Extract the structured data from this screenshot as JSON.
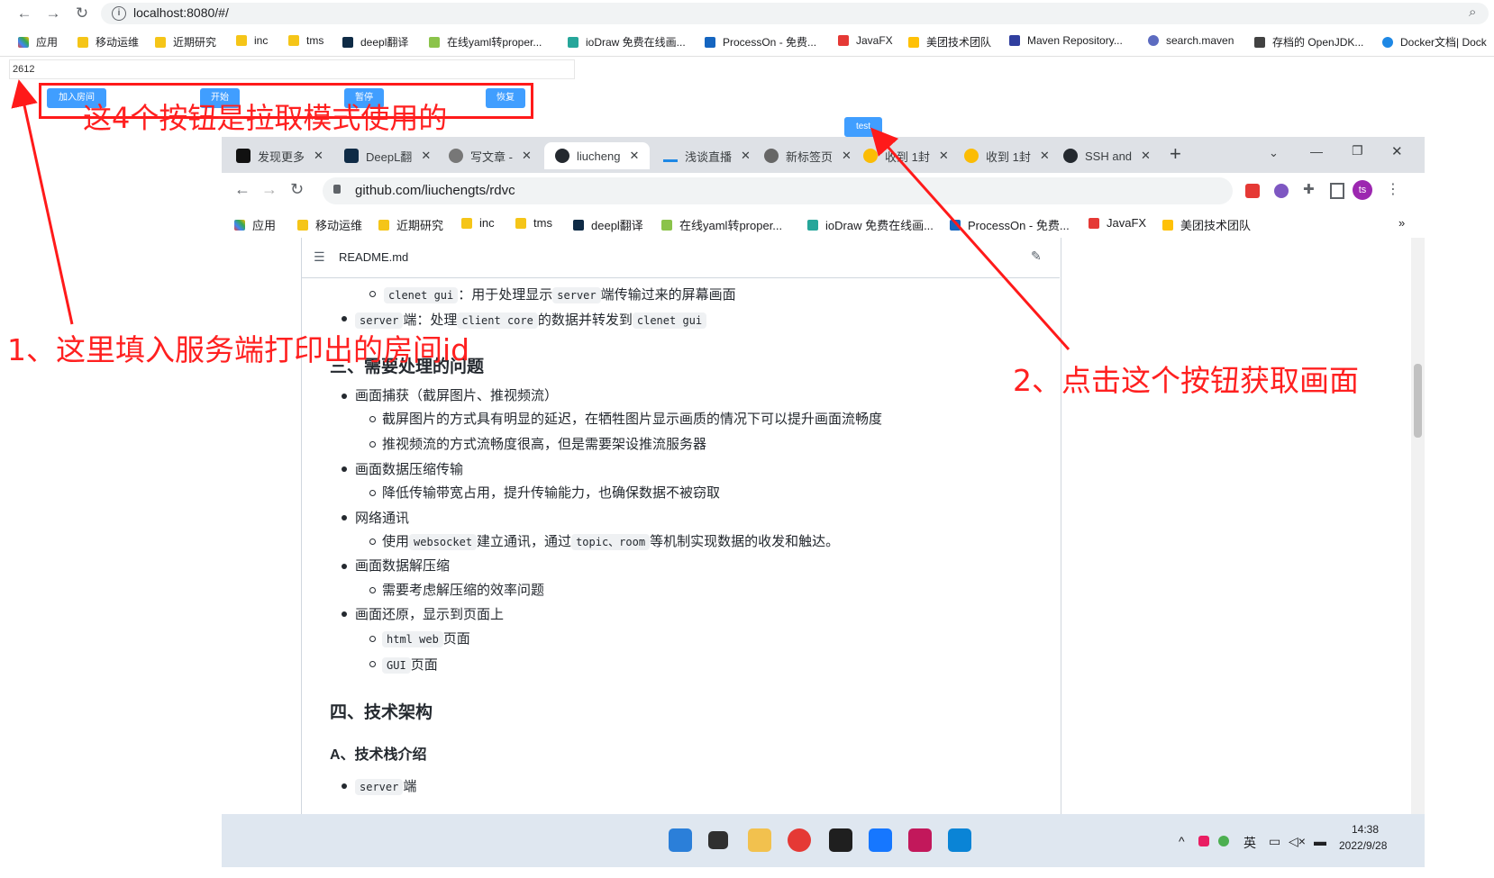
{
  "outer_browser": {
    "url": "localhost:8080/#/",
    "bookmarks": [
      "应用",
      "移动运维",
      "近期研究",
      "inc",
      "tms",
      "deepl翻译",
      "在线yaml转proper...",
      "ioDraw 免费在线画...",
      "ProcessOn - 免费...",
      "JavaFX",
      "美团技术团队",
      "Maven Repository...",
      "search.maven",
      "存档的 OpenJDK...",
      "Docker文档| Dock"
    ]
  },
  "page": {
    "room_input_value": "2612",
    "buttons": {
      "join": "加入房间",
      "start": "开始",
      "pause": "暂停",
      "resume": "恢复",
      "test": "test"
    }
  },
  "annotations": {
    "pull_mode_note": "这4个按钮是拉取模式使用的",
    "step1": "1、这里填入服务端打印出的房间id",
    "step2": "2、点击这个按钮获取画面"
  },
  "inner_browser": {
    "tabs": [
      "发现更多",
      "DeepL翻",
      "写文章 -",
      "liucheng",
      "浅谈直播",
      "新标签页",
      "收到 1封",
      "收到 1封",
      "SSH and"
    ],
    "url": "github.com/liuchengts/rdvc",
    "avatar": "ts",
    "bookmarks": [
      "应用",
      "移动运维",
      "近期研究",
      "inc",
      "tms",
      "deepl翻译",
      "在线yaml转proper...",
      "ioDraw 免费在线画...",
      "ProcessOn - 免费...",
      "JavaFX",
      "美团技术团队"
    ],
    "more_bookmarks": "»"
  },
  "readme": {
    "file_name": "README.md",
    "lines": {
      "gui_code": "clenet gui",
      "gui_text": "：用于处理显示",
      "gui_code2": "server",
      "gui_text2": "端传输过来的屏幕画面",
      "server_code": "server",
      "server_text": "端：处理",
      "server_code2": "client core",
      "server_text2": "的数据并转发到",
      "server_code3": "clenet gui",
      "h_problems": "三、需要处理的问题",
      "capture": "画面捕获（截屏图片、推视频流）",
      "capture_1": "截屏图片的方式具有明显的延迟，在牺牲图片显示画质的情况下可以提升画面流畅度",
      "capture_2": "推视频流的方式流畅度很高，但是需要架设推流服务器",
      "compress": "画面数据压缩传输",
      "compress_1": "降低传输带宽占用，提升传输能力，也确保数据不被窃取",
      "network": "网络通讯",
      "network_1a": "使用",
      "network_code1": "websocket",
      "network_1b": "建立通讯，通过",
      "network_code2": "topic、room",
      "network_1c": "等机制实现数据的收发和触达。",
      "decompress": "画面数据解压缩",
      "decompress_1": "需要考虑解压缩的效率问题",
      "restore": "画面还原，显示到页面上",
      "restore_code1": "html web",
      "restore_1": "页面",
      "restore_code2": "GUI",
      "restore_2": "页面",
      "h_arch": "四、技术架构",
      "h_stack": "A、技术栈介绍",
      "stack_code": "server",
      "stack_text": "端"
    }
  },
  "taskbar": {
    "ime": "英",
    "time": "14:38",
    "date": "2022/9/28"
  }
}
